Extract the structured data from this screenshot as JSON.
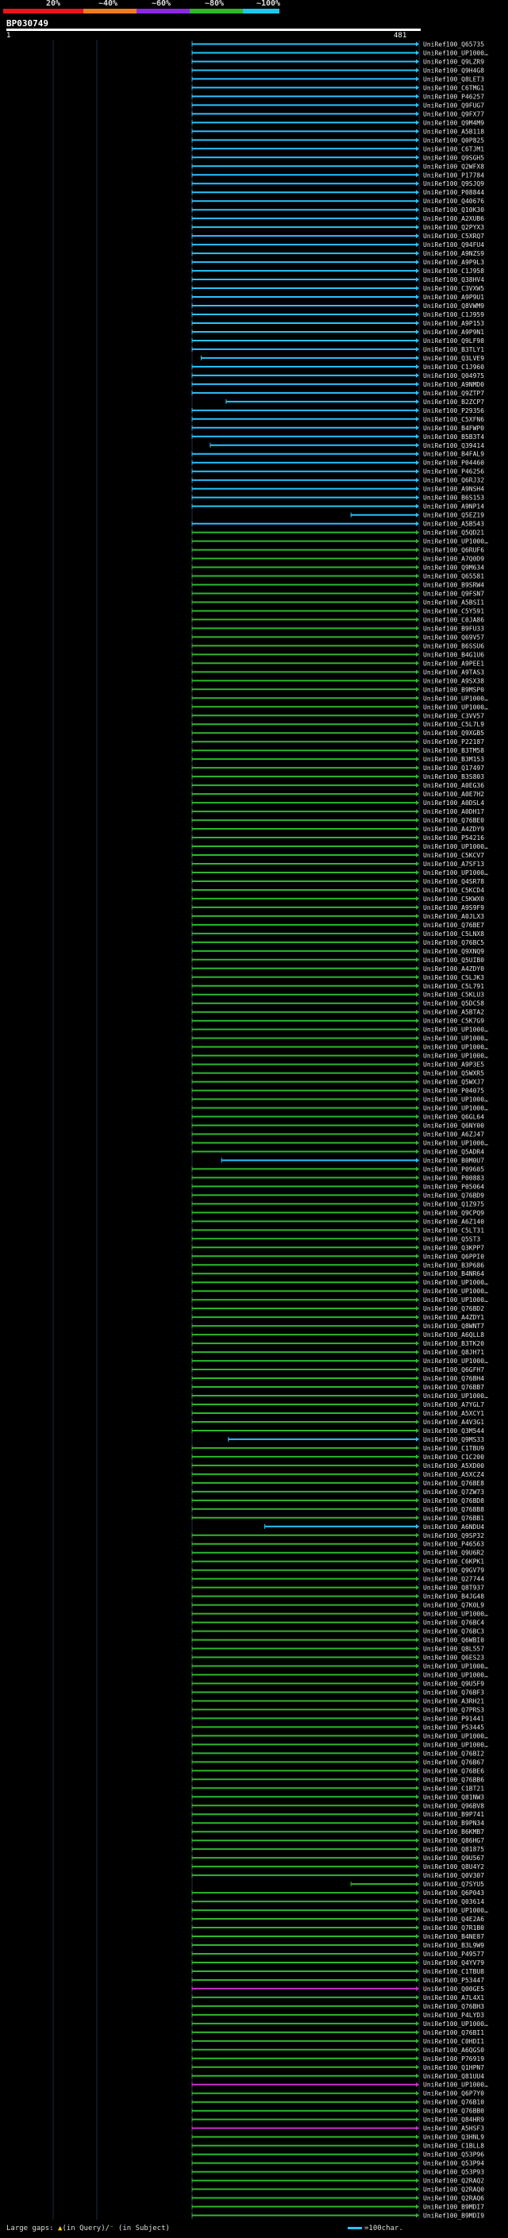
{
  "scale": {
    "labels": [
      "20%",
      "~40%",
      "~60%",
      "~80%",
      "~100%"
    ],
    "colors": [
      "#e8141e",
      "#f07c1e",
      "#8a2be2",
      "#2db82d",
      "#1ec8e8"
    ]
  },
  "query": {
    "title": "BP030749",
    "start": "1",
    "end": "481"
  },
  "colors": {
    "cyan": "#29c4ff",
    "green": "#2db82d",
    "magenta": "#c832c8",
    "grid": "#1c2a44",
    "label": "#e6e6e6"
  },
  "hits": [
    {
      "id": "UniRef100_Q65735",
      "color": "cyan"
    },
    {
      "id": "UniRef100_UP1000…",
      "color": "cyan"
    },
    {
      "id": "UniRef100_Q9LZR9",
      "color": "cyan"
    },
    {
      "id": "UniRef100_Q9H4G8",
      "color": "cyan"
    },
    {
      "id": "UniRef100_Q8LET3",
      "color": "cyan"
    },
    {
      "id": "UniRef100_C6TMG1",
      "color": "cyan"
    },
    {
      "id": "UniRef100_P46257",
      "color": "cyan"
    },
    {
      "id": "UniRef100_Q9FUG7",
      "color": "cyan"
    },
    {
      "id": "UniRef100_Q9FX77",
      "color": "cyan"
    },
    {
      "id": "UniRef100_Q9M4M9",
      "color": "cyan"
    },
    {
      "id": "UniRef100_A5B118",
      "color": "cyan"
    },
    {
      "id": "UniRef100_Q0P825",
      "color": "cyan"
    },
    {
      "id": "UniRef100_C6TJM1",
      "color": "cyan"
    },
    {
      "id": "UniRef100_Q9SGH5",
      "color": "cyan"
    },
    {
      "id": "UniRef100_Q2WFX8",
      "color": "cyan"
    },
    {
      "id": "UniRef100_P17784",
      "color": "cyan"
    },
    {
      "id": "UniRef100_Q9SJQ9",
      "color": "cyan"
    },
    {
      "id": "UniRef100_P08844",
      "color": "cyan"
    },
    {
      "id": "UniRef100_Q40676",
      "color": "cyan"
    },
    {
      "id": "UniRef100_Q10K30",
      "color": "cyan"
    },
    {
      "id": "UniRef100_A2XUB6",
      "color": "cyan"
    },
    {
      "id": "UniRef100_Q2PYX3",
      "color": "cyan"
    },
    {
      "id": "UniRef100_C5XRQ7",
      "color": "cyan"
    },
    {
      "id": "UniRef100_Q94FU4",
      "color": "cyan"
    },
    {
      "id": "UniRef100_A9NZS9",
      "color": "cyan"
    },
    {
      "id": "UniRef100_A9P9L3",
      "color": "cyan"
    },
    {
      "id": "UniRef100_C1J958",
      "color": "cyan"
    },
    {
      "id": "UniRef100_Q38HV4",
      "color": "cyan"
    },
    {
      "id": "UniRef100_C3VXW5",
      "color": "cyan"
    },
    {
      "id": "UniRef100_A9P9U1",
      "color": "cyan"
    },
    {
      "id": "UniRef100_Q8VWM9",
      "color": "cyan"
    },
    {
      "id": "UniRef100_C1J959",
      "color": "cyan"
    },
    {
      "id": "UniRef100_A9P153",
      "color": "cyan"
    },
    {
      "id": "UniRef100_A9P9N1",
      "color": "cyan"
    },
    {
      "id": "UniRef100_Q9LF98",
      "color": "cyan"
    },
    {
      "id": "UniRef100_B3TLY1",
      "color": "cyan"
    },
    {
      "id": "UniRef100_Q3LVE9",
      "color": "cyan",
      "start": 0.04
    },
    {
      "id": "UniRef100_C1J960",
      "color": "cyan"
    },
    {
      "id": "UniRef100_Q04975",
      "color": "cyan"
    },
    {
      "id": "UniRef100_A9NMD0",
      "color": "cyan"
    },
    {
      "id": "UniRef100_Q9ZTP7",
      "color": "cyan"
    },
    {
      "id": "UniRef100_B2ZCP7",
      "color": "cyan",
      "start": 0.15
    },
    {
      "id": "UniRef100_P29356",
      "color": "cyan"
    },
    {
      "id": "UniRef100_C5XFN6",
      "color": "cyan"
    },
    {
      "id": "UniRef100_B4FWP0",
      "color": "cyan"
    },
    {
      "id": "UniRef100_B5B3T4",
      "color": "cyan"
    },
    {
      "id": "UniRef100_Q39414",
      "color": "cyan",
      "start": 0.08
    },
    {
      "id": "UniRef100_B4FAL9",
      "color": "cyan"
    },
    {
      "id": "UniRef100_P04460",
      "color": "cyan"
    },
    {
      "id": "UniRef100_P46256",
      "color": "cyan"
    },
    {
      "id": "UniRef100_Q6RJ32",
      "color": "cyan"
    },
    {
      "id": "UniRef100_A9NSH4",
      "color": "cyan"
    },
    {
      "id": "UniRef100_B6S153",
      "color": "cyan"
    },
    {
      "id": "UniRef100_A9NP14",
      "color": "cyan"
    },
    {
      "id": "UniRef100_Q5EZ19",
      "color": "cyan",
      "start": 0.7
    },
    {
      "id": "UniRef100_A5B543",
      "color": "cyan"
    },
    {
      "id": "UniRef100_Q5QD21",
      "color": "green"
    },
    {
      "id": "UniRef100_UP1000…",
      "color": "green"
    },
    {
      "id": "UniRef100_Q6RUF6",
      "color": "green"
    },
    {
      "id": "UniRef100_A7Q0D9",
      "color": "green"
    },
    {
      "id": "UniRef100_Q9M634",
      "color": "green"
    },
    {
      "id": "UniRef100_Q65581",
      "color": "green"
    },
    {
      "id": "UniRef100_B9SRW4",
      "color": "green"
    },
    {
      "id": "UniRef100_Q9FSN7",
      "color": "green"
    },
    {
      "id": "UniRef100_A5BSI1",
      "color": "green"
    },
    {
      "id": "UniRef100_C5Y591",
      "color": "green"
    },
    {
      "id": "UniRef100_C0JA86",
      "color": "green"
    },
    {
      "id": "UniRef100_B9FU33",
      "color": "green"
    },
    {
      "id": "UniRef100_Q69V57",
      "color": "green"
    },
    {
      "id": "UniRef100_B6SSU6",
      "color": "green"
    },
    {
      "id": "UniRef100_B4G1U6",
      "color": "green"
    },
    {
      "id": "UniRef100_A9PEE1",
      "color": "green"
    },
    {
      "id": "UniRef100_A9TAS3",
      "color": "green"
    },
    {
      "id": "UniRef100_A9SX38",
      "color": "green"
    },
    {
      "id": "UniRef100_B9MSP0",
      "color": "green"
    },
    {
      "id": "UniRef100_UP1000…",
      "color": "green"
    },
    {
      "id": "UniRef100_UP1000…",
      "color": "green"
    },
    {
      "id": "UniRef100_C3VV57",
      "color": "green"
    },
    {
      "id": "UniRef100_C5L7L9",
      "color": "green"
    },
    {
      "id": "UniRef100_Q9XGB5",
      "color": "green"
    },
    {
      "id": "UniRef100_P22187",
      "color": "green"
    },
    {
      "id": "UniRef100_B3TM58",
      "color": "green"
    },
    {
      "id": "UniRef100_B3M153",
      "color": "green"
    },
    {
      "id": "UniRef100_Q17497",
      "color": "green"
    },
    {
      "id": "UniRef100_B3S803",
      "color": "green"
    },
    {
      "id": "UniRef100_A0EG36",
      "color": "green"
    },
    {
      "id": "UniRef100_A0E7H2",
      "color": "green"
    },
    {
      "id": "UniRef100_A0DSL4",
      "color": "green"
    },
    {
      "id": "UniRef100_A0DH17",
      "color": "green"
    },
    {
      "id": "UniRef100_Q76BE0",
      "color": "green"
    },
    {
      "id": "UniRef100_A4ZDY9",
      "color": "green"
    },
    {
      "id": "UniRef100_P54216",
      "color": "green"
    },
    {
      "id": "UniRef100_UP1000…",
      "color": "green"
    },
    {
      "id": "UniRef100_C5KCV7",
      "color": "green"
    },
    {
      "id": "UniRef100_A7SF13",
      "color": "green"
    },
    {
      "id": "UniRef100_UP1000…",
      "color": "green"
    },
    {
      "id": "UniRef100_Q4SR78",
      "color": "green"
    },
    {
      "id": "UniRef100_C5KCD4",
      "color": "green"
    },
    {
      "id": "UniRef100_C5KWX0",
      "color": "green"
    },
    {
      "id": "UniRef100_A9S9F9",
      "color": "green"
    },
    {
      "id": "UniRef100_A0JLX3",
      "color": "green"
    },
    {
      "id": "UniRef100_Q76BE7",
      "color": "green"
    },
    {
      "id": "UniRef100_C5LNX8",
      "color": "green"
    },
    {
      "id": "UniRef100_Q76BC5",
      "color": "green"
    },
    {
      "id": "UniRef100_Q9XNQ9",
      "color": "green"
    },
    {
      "id": "UniRef100_Q5UIB0",
      "color": "green"
    },
    {
      "id": "UniRef100_A4ZDY0",
      "color": "green"
    },
    {
      "id": "UniRef100_C5LJK3",
      "color": "green"
    },
    {
      "id": "UniRef100_C5L791",
      "color": "green"
    },
    {
      "id": "UniRef100_C5KLU3",
      "color": "green"
    },
    {
      "id": "UniRef100_Q5DC58",
      "color": "green"
    },
    {
      "id": "UniRef100_A5BTA2",
      "color": "green"
    },
    {
      "id": "UniRef100_C5K7G9",
      "color": "green"
    },
    {
      "id": "UniRef100_UP1000…",
      "color": "green"
    },
    {
      "id": "UniRef100_UP1000…",
      "color": "green"
    },
    {
      "id": "UniRef100_UP1000…",
      "color": "green"
    },
    {
      "id": "UniRef100_UP1000…",
      "color": "green"
    },
    {
      "id": "UniRef100_A9P3E5",
      "color": "green"
    },
    {
      "id": "UniRef100_Q5WXR5",
      "color": "green"
    },
    {
      "id": "UniRef100_Q5WXJ7",
      "color": "green"
    },
    {
      "id": "UniRef100_P04075",
      "color": "green"
    },
    {
      "id": "UniRef100_UP1000…",
      "color": "green"
    },
    {
      "id": "UniRef100_UP1000…",
      "color": "green"
    },
    {
      "id": "UniRef100_Q6GL64",
      "color": "green"
    },
    {
      "id": "UniRef100_Q6NY00",
      "color": "green"
    },
    {
      "id": "UniRef100_A6ZJ47",
      "color": "green"
    },
    {
      "id": "UniRef100_UP1000…",
      "color": "green"
    },
    {
      "id": "UniRef100_Q5ADR4",
      "color": "green"
    },
    {
      "id": "UniRef100_B0M0U7",
      "color": "cyan",
      "start": 0.13
    },
    {
      "id": "UniRef100_P09605",
      "color": "green"
    },
    {
      "id": "UniRef100_P00883",
      "color": "green"
    },
    {
      "id": "UniRef100_P05064",
      "color": "green"
    },
    {
      "id": "UniRef100_Q76BD9",
      "color": "green"
    },
    {
      "id": "UniRef100_Q1Z975",
      "color": "green"
    },
    {
      "id": "UniRef100_Q9CPQ9",
      "color": "green"
    },
    {
      "id": "UniRef100_A6Z140",
      "color": "green"
    },
    {
      "id": "UniRef100_C5LT31",
      "color": "green"
    },
    {
      "id": "UniRef100_Q5ST3",
      "color": "green"
    },
    {
      "id": "UniRef100_Q3KPP7",
      "color": "green"
    },
    {
      "id": "UniRef100_Q6PPI0",
      "color": "green"
    },
    {
      "id": "UniRef100_B3P686",
      "color": "green"
    },
    {
      "id": "UniRef100_B4NR64",
      "color": "green"
    },
    {
      "id": "UniRef100_UP1000…",
      "color": "green"
    },
    {
      "id": "UniRef100_UP1000…",
      "color": "green"
    },
    {
      "id": "UniRef100_UP1000…",
      "color": "green"
    },
    {
      "id": "UniRef100_Q76BD2",
      "color": "green"
    },
    {
      "id": "UniRef100_A4ZDY1",
      "color": "green"
    },
    {
      "id": "UniRef100_Q8WNT7",
      "color": "green"
    },
    {
      "id": "UniRef100_A6QLL8",
      "color": "green"
    },
    {
      "id": "UniRef100_B3TK20",
      "color": "green"
    },
    {
      "id": "UniRef100_Q8JH71",
      "color": "green"
    },
    {
      "id": "UniRef100_UP1000…",
      "color": "green"
    },
    {
      "id": "UniRef100_Q6GFH7",
      "color": "green"
    },
    {
      "id": "UniRef100_Q76BH4",
      "color": "green"
    },
    {
      "id": "UniRef100_Q76BB7",
      "color": "green"
    },
    {
      "id": "UniRef100_UP1000…",
      "color": "green"
    },
    {
      "id": "UniRef100_A7YGL7",
      "color": "green"
    },
    {
      "id": "UniRef100_A5XCY1",
      "color": "green"
    },
    {
      "id": "UniRef100_A4V3G1",
      "color": "green"
    },
    {
      "id": "UniRef100_Q3M544",
      "color": "green"
    },
    {
      "id": "UniRef100_Q9MS33",
      "color": "cyan",
      "start": 0.16
    },
    {
      "id": "UniRef100_C1TBU9",
      "color": "green"
    },
    {
      "id": "UniRef100_C1C200",
      "color": "green"
    },
    {
      "id": "UniRef100_A5XD00",
      "color": "green"
    },
    {
      "id": "UniRef100_A5XCZ4",
      "color": "green"
    },
    {
      "id": "UniRef100_Q76BE8",
      "color": "green"
    },
    {
      "id": "UniRef100_Q7ZW73",
      "color": "green"
    },
    {
      "id": "UniRef100_Q76BD8",
      "color": "green"
    },
    {
      "id": "UniRef100_Q76BB8",
      "color": "green"
    },
    {
      "id": "UniRef100_Q76BB1",
      "color": "green"
    },
    {
      "id": "UniRef100_A6NDU4",
      "color": "cyan",
      "start": 0.32
    },
    {
      "id": "UniRef100_Q9SP32",
      "color": "green"
    },
    {
      "id": "UniRef100_P46563",
      "color": "green"
    },
    {
      "id": "UniRef100_Q9U6R2",
      "color": "green"
    },
    {
      "id": "UniRef100_C6KPK1",
      "color": "green"
    },
    {
      "id": "UniRef100_Q9GV79",
      "color": "green"
    },
    {
      "id": "UniRef100_Q27744",
      "color": "green"
    },
    {
      "id": "UniRef100_Q8T937",
      "color": "green"
    },
    {
      "id": "UniRef100_B4JG48",
      "color": "green"
    },
    {
      "id": "UniRef100_Q7K0L9",
      "color": "green"
    },
    {
      "id": "UniRef100_UP1000…",
      "color": "green"
    },
    {
      "id": "UniRef100_Q76BC4",
      "color": "green"
    },
    {
      "id": "UniRef100_Q76BC3",
      "color": "green"
    },
    {
      "id": "UniRef100_Q6WBI0",
      "color": "green"
    },
    {
      "id": "UniRef100_Q8L557",
      "color": "green"
    },
    {
      "id": "UniRef100_Q6ES23",
      "color": "green"
    },
    {
      "id": "UniRef100_UP1000…",
      "color": "green"
    },
    {
      "id": "UniRef100_UP1000…",
      "color": "green"
    },
    {
      "id": "UniRef100_Q9U5F9",
      "color": "green"
    },
    {
      "id": "UniRef100_Q76BF3",
      "color": "green"
    },
    {
      "id": "UniRef100_A3RH21",
      "color": "green"
    },
    {
      "id": "UniRef100_Q7PRS3",
      "color": "green"
    },
    {
      "id": "UniRef100_P91441",
      "color": "green"
    },
    {
      "id": "UniRef100_P53445",
      "color": "green"
    },
    {
      "id": "UniRef100_UP1000…",
      "color": "green"
    },
    {
      "id": "UniRef100_UP1000…",
      "color": "green"
    },
    {
      "id": "UniRef100_Q76BI2",
      "color": "green"
    },
    {
      "id": "UniRef100_Q76B67",
      "color": "green"
    },
    {
      "id": "UniRef100_Q76BE6",
      "color": "green"
    },
    {
      "id": "UniRef100_Q76BB6",
      "color": "green"
    },
    {
      "id": "UniRef100_C1BT21",
      "color": "green"
    },
    {
      "id": "UniRef100_Q81NW3",
      "color": "green"
    },
    {
      "id": "UniRef100_Q96BV8",
      "color": "green"
    },
    {
      "id": "UniRef100_B9P741",
      "color": "green"
    },
    {
      "id": "UniRef100_B9PN34",
      "color": "green"
    },
    {
      "id": "UniRef100_B6KMB7",
      "color": "green"
    },
    {
      "id": "UniRef100_Q86HG7",
      "color": "green"
    },
    {
      "id": "UniRef100_Q81875",
      "color": "green"
    },
    {
      "id": "UniRef100_Q9U567",
      "color": "green"
    },
    {
      "id": "UniRef100_Q8U4Y2",
      "color": "green"
    },
    {
      "id": "UniRef100_Q0V307",
      "color": "green"
    },
    {
      "id": "UniRef100_Q7SYU5",
      "color": "green",
      "start": 0.7
    },
    {
      "id": "UniRef100_Q6P043",
      "color": "green"
    },
    {
      "id": "UniRef100_Q03614",
      "color": "green"
    },
    {
      "id": "UniRef100_UP1000…",
      "color": "green"
    },
    {
      "id": "UniRef100_Q4E2A6",
      "color": "green"
    },
    {
      "id": "UniRef100_Q7R1B0",
      "color": "green"
    },
    {
      "id": "UniRef100_B4NE87",
      "color": "green"
    },
    {
      "id": "UniRef100_B3L9W9",
      "color": "green"
    },
    {
      "id": "UniRef100_P49577",
      "color": "green"
    },
    {
      "id": "UniRef100_Q4YV79",
      "color": "green"
    },
    {
      "id": "UniRef100_C1TBU8",
      "color": "green"
    },
    {
      "id": "UniRef100_P53447",
      "color": "green"
    },
    {
      "id": "UniRef100_Q00GE5",
      "color": "magenta"
    },
    {
      "id": "UniRef100_A7L4X1",
      "color": "green"
    },
    {
      "id": "UniRef100_Q76BH3",
      "color": "green"
    },
    {
      "id": "UniRef100_P4LYD3",
      "color": "green"
    },
    {
      "id": "UniRef100_UP1000…",
      "color": "green"
    },
    {
      "id": "UniRef100_Q76BI1",
      "color": "green"
    },
    {
      "id": "UniRef100_C0HDI1",
      "color": "green"
    },
    {
      "id": "UniRef100_A6QGS0",
      "color": "green"
    },
    {
      "id": "UniRef100_P76919",
      "color": "green"
    },
    {
      "id": "UniRef100_Q1HPN7",
      "color": "green"
    },
    {
      "id": "UniRef100_Q81UU4",
      "color": "green"
    },
    {
      "id": "UniRef100_UP1000…",
      "color": "magenta"
    },
    {
      "id": "UniRef100_Q6P7Y0",
      "color": "green"
    },
    {
      "id": "UniRef100_Q76B10",
      "color": "green"
    },
    {
      "id": "UniRef100_Q76BB0",
      "color": "green"
    },
    {
      "id": "UniRef100_Q84HR9",
      "color": "green"
    },
    {
      "id": "UniRef100_A5HSF3",
      "color": "magenta"
    },
    {
      "id": "UniRef100_Q3HNL9",
      "color": "green"
    },
    {
      "id": "UniRef100_C1BLL8",
      "color": "green"
    },
    {
      "id": "UniRef100_Q53P96",
      "color": "green"
    },
    {
      "id": "UniRef100_Q53P94",
      "color": "green"
    },
    {
      "id": "UniRef100_Q53P93",
      "color": "green"
    },
    {
      "id": "UniRef100_Q2RAQ2",
      "color": "green"
    },
    {
      "id": "UniRef100_Q2RAQ0",
      "color": "green"
    },
    {
      "id": "UniRef100_Q2RAQ6",
      "color": "green"
    },
    {
      "id": "UniRef100_B9MDI7",
      "color": "green"
    },
    {
      "id": "UniRef100_B9MDI9",
      "color": "green"
    }
  ],
  "footer": {
    "prefix": "Large gaps: ",
    "gap_icon": "▲",
    "query_gap_text": "(in Query)/",
    "subject_gap_icon": "⁻",
    "subject_gap_text": " (in Subject)"
  },
  "legend": {
    "text": "=100char."
  }
}
